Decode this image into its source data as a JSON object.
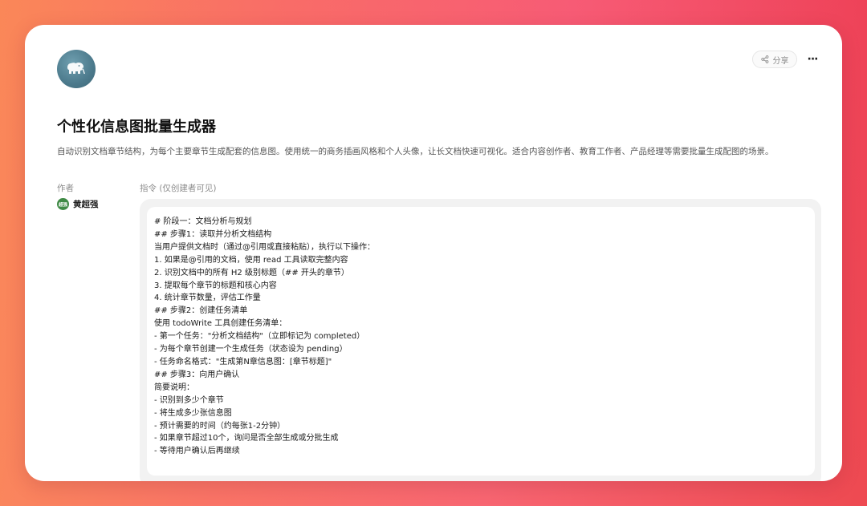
{
  "colors": {
    "background_gradient_start": "#f98a58",
    "background_gradient_end": "#e8304e",
    "author_avatar_bg": "#3f8a45",
    "avatar_bg": "#4c7a8c"
  },
  "header": {
    "avatar_icon": "elephant-icon",
    "share_label": "分享",
    "share_icon": "share-icon",
    "more_icon": "more-horizontal-icon",
    "more_label": "···"
  },
  "app": {
    "title": "个性化信息图批量生成器",
    "description": "自动识别文档章节结构，为每个主要章节生成配套的信息图。使用统一的商务插画风格和个人头像，让长文档快速可视化。适合内容创作者、教育工作者、产品经理等需要批量生成配图的场景。"
  },
  "author": {
    "label": "作者",
    "avatar_text": "超强",
    "name": "黄超强"
  },
  "instructions": {
    "label": "指令 (仅创建者可见)",
    "lines": [
      "# 阶段一：文档分析与规划",
      "## 步骤1：读取并分析文档结构",
      "当用户提供文档时（通过@引用或直接粘贴），执行以下操作：",
      "1. 如果是@引用的文档，使用 read 工具读取完整内容",
      "2. 识别文档中的所有 H2 级别标题（## 开头的章节）",
      "3. 提取每个章节的标题和核心内容",
      "4. 统计章节数量，评估工作量",
      "## 步骤2：创建任务清单",
      "使用 todoWrite 工具创建任务清单：",
      "- 第一个任务：\"分析文档结构\"（立即标记为 completed）",
      "- 为每个章节创建一个生成任务（状态设为 pending）",
      "- 任务命名格式：\"生成第N章信息图：[章节标题]\"",
      "## 步骤3：向用户确认",
      "简要说明：",
      "- 识别到多少个章节",
      "- 将生成多少张信息图",
      "- 预计需要的时间（约每张1-2分钟）",
      "- 如果章节超过10个，询问是否全部生成或分批生成",
      "- 等待用户确认后再继续"
    ]
  }
}
